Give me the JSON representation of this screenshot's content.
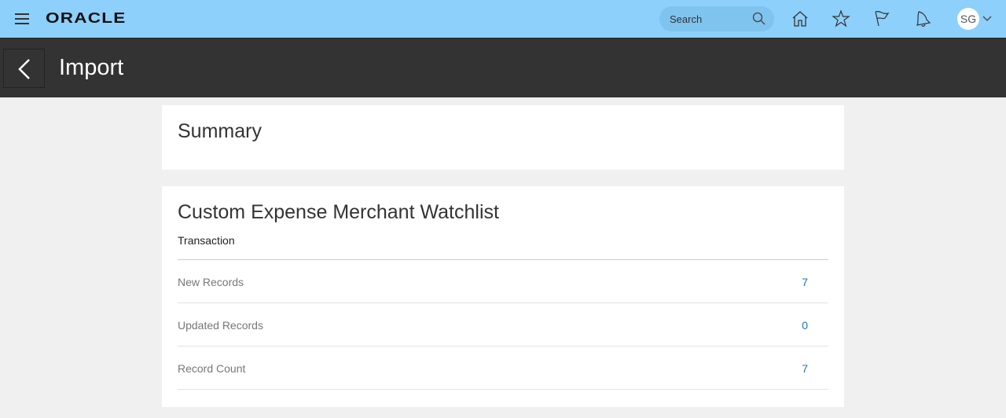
{
  "header": {
    "logo": "ORACLE",
    "search_placeholder": "Search",
    "avatar_initials": "SG",
    "brand_color": "#8dd0fb"
  },
  "page": {
    "title": "Import"
  },
  "summary": {
    "title": "Summary"
  },
  "section": {
    "title": "Custom Expense Merchant Watchlist",
    "subtitle": "Transaction",
    "rows": [
      {
        "label": "New Records",
        "value": "7"
      },
      {
        "label": "Updated Records",
        "value": "0"
      },
      {
        "label": "Record Count",
        "value": "7"
      }
    ]
  }
}
